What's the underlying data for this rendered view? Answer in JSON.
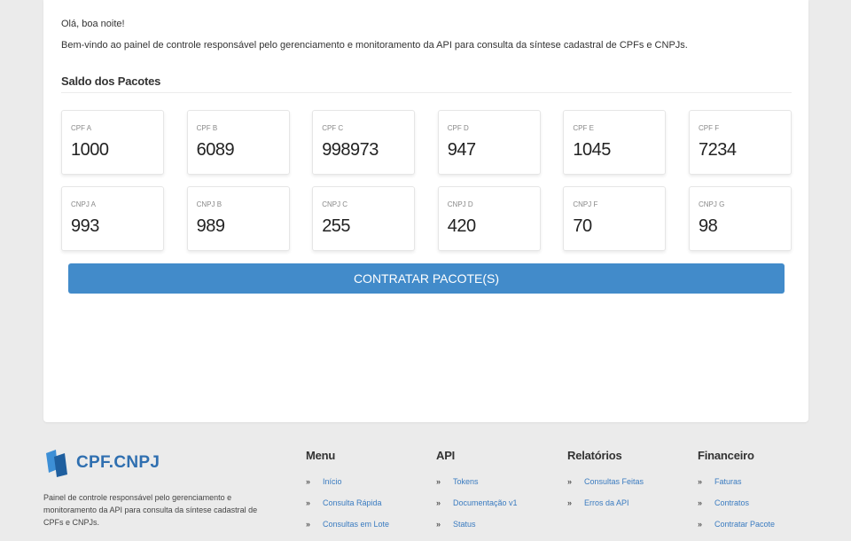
{
  "main": {
    "greeting": "Olá, boa noite!",
    "welcome": "Bem-vindo ao painel de controle responsável pelo gerenciamento e monitoramento da API para consulta da síntese cadastral de CPFs e CNPJs.",
    "section_title": "Saldo dos Pacotes",
    "cpf_cards": [
      {
        "label": "CPF A",
        "value": "1000"
      },
      {
        "label": "CPF B",
        "value": "6089"
      },
      {
        "label": "CPF C",
        "value": "998973"
      },
      {
        "label": "CPF D",
        "value": "947"
      },
      {
        "label": "CPF E",
        "value": "1045"
      },
      {
        "label": "CPF F",
        "value": "7234"
      }
    ],
    "cnpj_cards": [
      {
        "label": "CNPJ A",
        "value": "993"
      },
      {
        "label": "CNPJ B",
        "value": "989"
      },
      {
        "label": "CNPJ C",
        "value": "255"
      },
      {
        "label": "CNPJ D",
        "value": "420"
      },
      {
        "label": "CNPJ F",
        "value": "70"
      },
      {
        "label": "CNPJ G",
        "value": "98"
      }
    ],
    "buy_button": "CONTRATAR PACOTE(S)"
  },
  "footer": {
    "logo_text": "CPF.CNPJ",
    "description": "Painel de controle responsável pelo gerenciamento e monitoramento da API para consulta da síntese cadastral de CPFs e CNPJs.",
    "columns": [
      {
        "title": "Menu",
        "links": [
          "Início",
          "Consulta Rápida",
          "Consultas em Lote"
        ]
      },
      {
        "title": "API",
        "links": [
          "Tokens",
          "Documentação v1",
          "Status"
        ]
      },
      {
        "title": "Relatórios",
        "links": [
          "Consultas Feitas",
          "Erros da API"
        ]
      },
      {
        "title": "Financeiro",
        "links": [
          "Faturas",
          "Contratos",
          "Contratar Pacote"
        ]
      }
    ]
  },
  "colors": {
    "accent": "#428bca",
    "link": "#3a7bc0",
    "background": "#ebebeb",
    "panel": "#ffffff"
  },
  "icons": {
    "logo": "cpf-cnpj-logo-icon",
    "link_bullet": "chevron-right-icon"
  }
}
